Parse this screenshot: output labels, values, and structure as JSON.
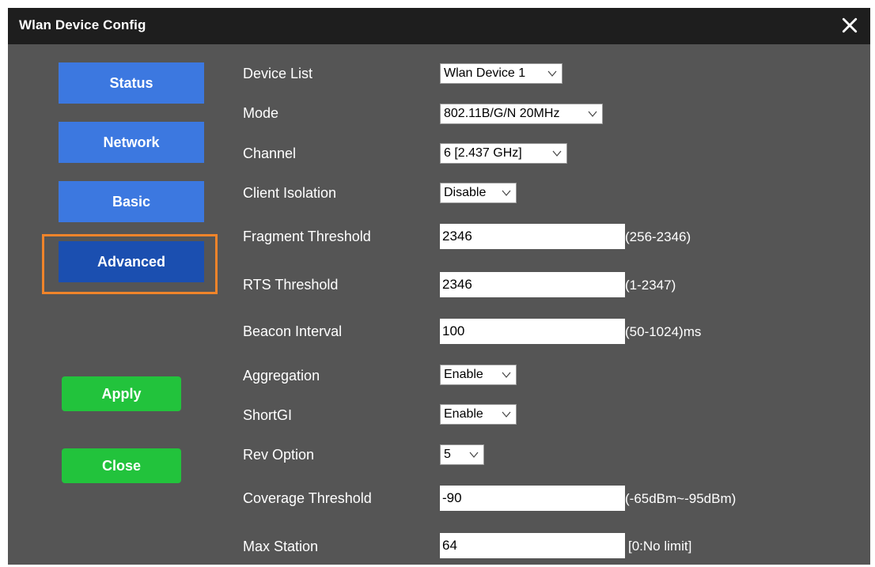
{
  "window": {
    "title": "Wlan Device Config"
  },
  "nav": {
    "status": "Status",
    "network": "Network",
    "basic": "Basic",
    "advanced": "Advanced"
  },
  "actions": {
    "apply": "Apply",
    "close": "Close"
  },
  "form": {
    "device_list": {
      "label": "Device List",
      "value": "Wlan Device 1"
    },
    "mode": {
      "label": "Mode",
      "value": "802.11B/G/N 20MHz"
    },
    "channel": {
      "label": "Channel",
      "value": "6 [2.437 GHz]"
    },
    "client_isolation": {
      "label": "Client Isolation",
      "value": "Disable"
    },
    "fragment_threshold": {
      "label": "Fragment Threshold",
      "value": "2346",
      "hint": "(256-2346)"
    },
    "rts_threshold": {
      "label": "RTS Threshold",
      "value": "2346",
      "hint": "(1-2347)"
    },
    "beacon_interval": {
      "label": "Beacon Interval",
      "value": "100",
      "hint": "(50-1024)ms"
    },
    "aggregation": {
      "label": "Aggregation",
      "value": "Enable"
    },
    "short_gi": {
      "label": "ShortGI",
      "value": "Enable"
    },
    "rev_option": {
      "label": "Rev Option",
      "value": "5"
    },
    "coverage_threshold": {
      "label": "Coverage Threshold",
      "value": "-90",
      "hint": "(-65dBm~-95dBm)"
    },
    "max_station": {
      "label": "Max Station",
      "value": "64",
      "hint": "[0:No limit]"
    }
  },
  "icons": {
    "close": "close-icon",
    "dropdown": "chevron-down-icon"
  },
  "colors": {
    "nav_button": "#3c78e0",
    "nav_active": "#1b4fb0",
    "focus_ring": "#f0842a",
    "action_button": "#22c33c",
    "panel": "#555555",
    "titlebar": "#1e1e1e"
  }
}
